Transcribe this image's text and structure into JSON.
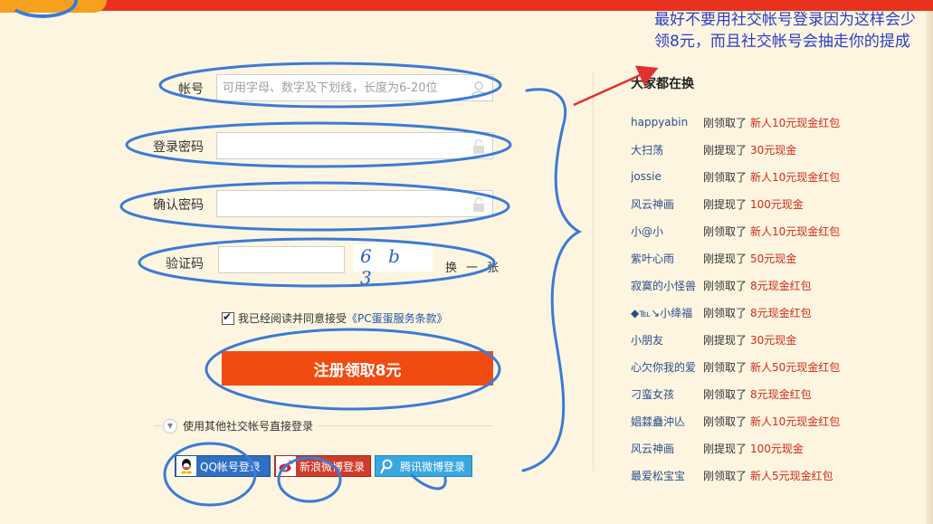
{
  "form": {
    "account_label": "帐号",
    "account_placeholder": "可用字母、数字及下划线，长度为6-20位",
    "password_label": "登录密码",
    "confirm_label": "确认密码",
    "captcha_label": "验证码",
    "captcha_text": "6 b 3",
    "captcha_refresh": "换一张",
    "agree_text": "我已经阅读并同意接受",
    "agree_terms": "《PC蛋蛋服务条款》",
    "submit_label": "注册领取8元"
  },
  "social": {
    "title": "使用其他社交帐号直接登录",
    "qq": "QQ帐号登录",
    "weibo": "新浪微博登录",
    "tweibo": "腾讯微博登录"
  },
  "sidebar": {
    "title": "大家都在换",
    "items": [
      {
        "user": "happyabin",
        "action": "刚领取了",
        "prize": "新人10元现金红包"
      },
      {
        "user": "大扫荡",
        "action": "刚提现了",
        "prize": "30元现金"
      },
      {
        "user": "jossie",
        "action": "刚领取了",
        "prize": "新人10元现金红包"
      },
      {
        "user": "风云神画",
        "action": "刚提现了",
        "prize": "100元现金"
      },
      {
        "user": "小@小",
        "action": "刚领取了",
        "prize": "新人10元现金红包"
      },
      {
        "user": "紫叶心雨",
        "action": "刚提现了",
        "prize": "50元现金"
      },
      {
        "user": "寂寞的小怪兽",
        "action": "刚领取了",
        "prize": "8元现金红包"
      },
      {
        "user": "◆℡↘小绛福",
        "action": "刚领取了",
        "prize": "8元现金红包"
      },
      {
        "user": "小朋友",
        "action": "刚提现了",
        "prize": "30元现金"
      },
      {
        "user": "心欠你我的爱",
        "action": "刚领取了",
        "prize": "新人50元现金红包"
      },
      {
        "user": "刁蛮女孩",
        "action": "刚领取了",
        "prize": "8元现金红包"
      },
      {
        "user": "娼㵘蠱沖亾",
        "action": "刚领取了",
        "prize": "新人10元现金红包"
      },
      {
        "user": "风云神画",
        "action": "刚提现了",
        "prize": "100元现金"
      },
      {
        "user": "最爱松宝宝",
        "action": "刚领取了",
        "prize": "新人5元现金红包"
      }
    ]
  },
  "annotation": {
    "text": "最好不要用社交帐号登录因为这样会少领8元，而且社交帐号会抽走你的提成"
  },
  "colors": {
    "accent": "#f24b12",
    "topbar": "#e8321e",
    "link": "#2b4f8a",
    "prize": "#d42a1a",
    "annotation": "#2a3fcb",
    "scribble": "#3b7bd6"
  }
}
